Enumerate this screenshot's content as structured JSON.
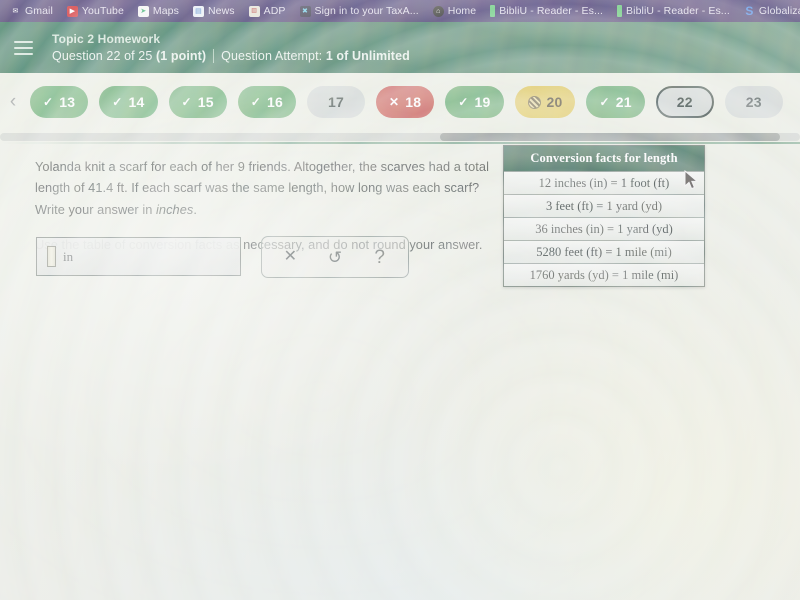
{
  "browser": {
    "bookmarks": [
      {
        "label": "Gmail",
        "icon": "gmail-icon",
        "icon_class": "ico-gmail",
        "glyph": "M"
      },
      {
        "label": "YouTube",
        "icon": "youtube-icon",
        "icon_class": "ico-youtube",
        "glyph": "▶"
      },
      {
        "label": "Maps",
        "icon": "maps-icon",
        "icon_class": "ico-maps",
        "glyph": "➤"
      },
      {
        "label": "News",
        "icon": "news-icon",
        "icon_class": "ico-news",
        "glyph": "▤"
      },
      {
        "label": "ADP",
        "icon": "adp-icon",
        "icon_class": "ico-adp",
        "glyph": "ADP"
      },
      {
        "label": "Sign in to your TaxA...",
        "icon": "taxact-icon",
        "icon_class": "ico-taxact",
        "glyph": "✖"
      },
      {
        "label": "Home",
        "icon": "home-icon",
        "icon_class": "ico-home",
        "glyph": "⌂"
      },
      {
        "label": "BibliU - Reader - Es...",
        "icon": "bibliu-icon",
        "icon_class": "ico-biblio",
        "glyph": ""
      },
      {
        "label": "BibliU - Reader - Es...",
        "icon": "bibliu-icon",
        "icon_class": "ico-biblio",
        "glyph": ""
      },
      {
        "label": "Globalization A Clo...",
        "icon": "scribd-icon",
        "icon_class": "ico-scribd",
        "glyph": "S"
      }
    ]
  },
  "header": {
    "menu_icon": "hamburger-menu-icon",
    "topic": "Topic 2 Homework",
    "question_counter": "Question 22 of 25",
    "points": "(1 point)",
    "attempt": "Question Attempt: 1 of Unlimited",
    "attempt_label": "Question Attempt:",
    "attempt_value": "1 of Unlimited",
    "bg_color": "#2c6a4e"
  },
  "nav": {
    "back_glyph": "‹",
    "pills": [
      {
        "number": "13",
        "state": "correct",
        "class": "p-correct",
        "mark": "✓"
      },
      {
        "number": "14",
        "state": "correct",
        "class": "p-correct",
        "mark": "✓"
      },
      {
        "number": "15",
        "state": "correct",
        "class": "p-correct",
        "mark": "✓"
      },
      {
        "number": "16",
        "state": "correct",
        "class": "p-correct",
        "mark": "✓"
      },
      {
        "number": "17",
        "state": "unanswered",
        "class": "p-unseen",
        "mark": ""
      },
      {
        "number": "18",
        "state": "incorrect",
        "class": "p-wrong",
        "mark": "✕"
      },
      {
        "number": "19",
        "state": "correct",
        "class": "p-correct",
        "mark": "✓"
      },
      {
        "number": "20",
        "state": "partial",
        "class": "p-partial",
        "mark": "hatch"
      },
      {
        "number": "21",
        "state": "correct",
        "class": "p-correct",
        "mark": "✓"
      },
      {
        "number": "22",
        "state": "current",
        "class": "p-current",
        "mark": ""
      },
      {
        "number": "23",
        "state": "unanswered",
        "class": "p-unseen",
        "mark": ""
      }
    ],
    "colors": {
      "correct": "#5ea466",
      "incorrect": "#c4504a",
      "partial": "#ddc352",
      "unanswered": "#cbd2cf",
      "current_border": "#2b3a34"
    }
  },
  "question": {
    "paragraph1": "Yolanda knit a scarf for each of her 9 friends. Altogether, the scarves had a total length of 41.4 ft. If each scarf was the same length, how long was each scarf? Write your answer in ",
    "paragraph1_emphasis": "inches",
    "paragraph1_end": ".",
    "paragraph2": "Use the table of conversion facts as necessary, and do not round your answer."
  },
  "conversion_table": {
    "title": "Conversion facts for length",
    "rows": [
      "12 inches (in) = 1 foot (ft)",
      "3 feet (ft) = 1 yard (yd)",
      "36 inches (in) = 1 yard (yd)",
      "5280 feet (ft) = 1 mile (mi)",
      "1760 yards (yd) = 1 mile (mi)"
    ]
  },
  "answer": {
    "value": "",
    "placeholder": "",
    "unit": "in"
  },
  "tools": {
    "clear_label": "✕",
    "undo_label": "↺",
    "help_label": "?"
  }
}
